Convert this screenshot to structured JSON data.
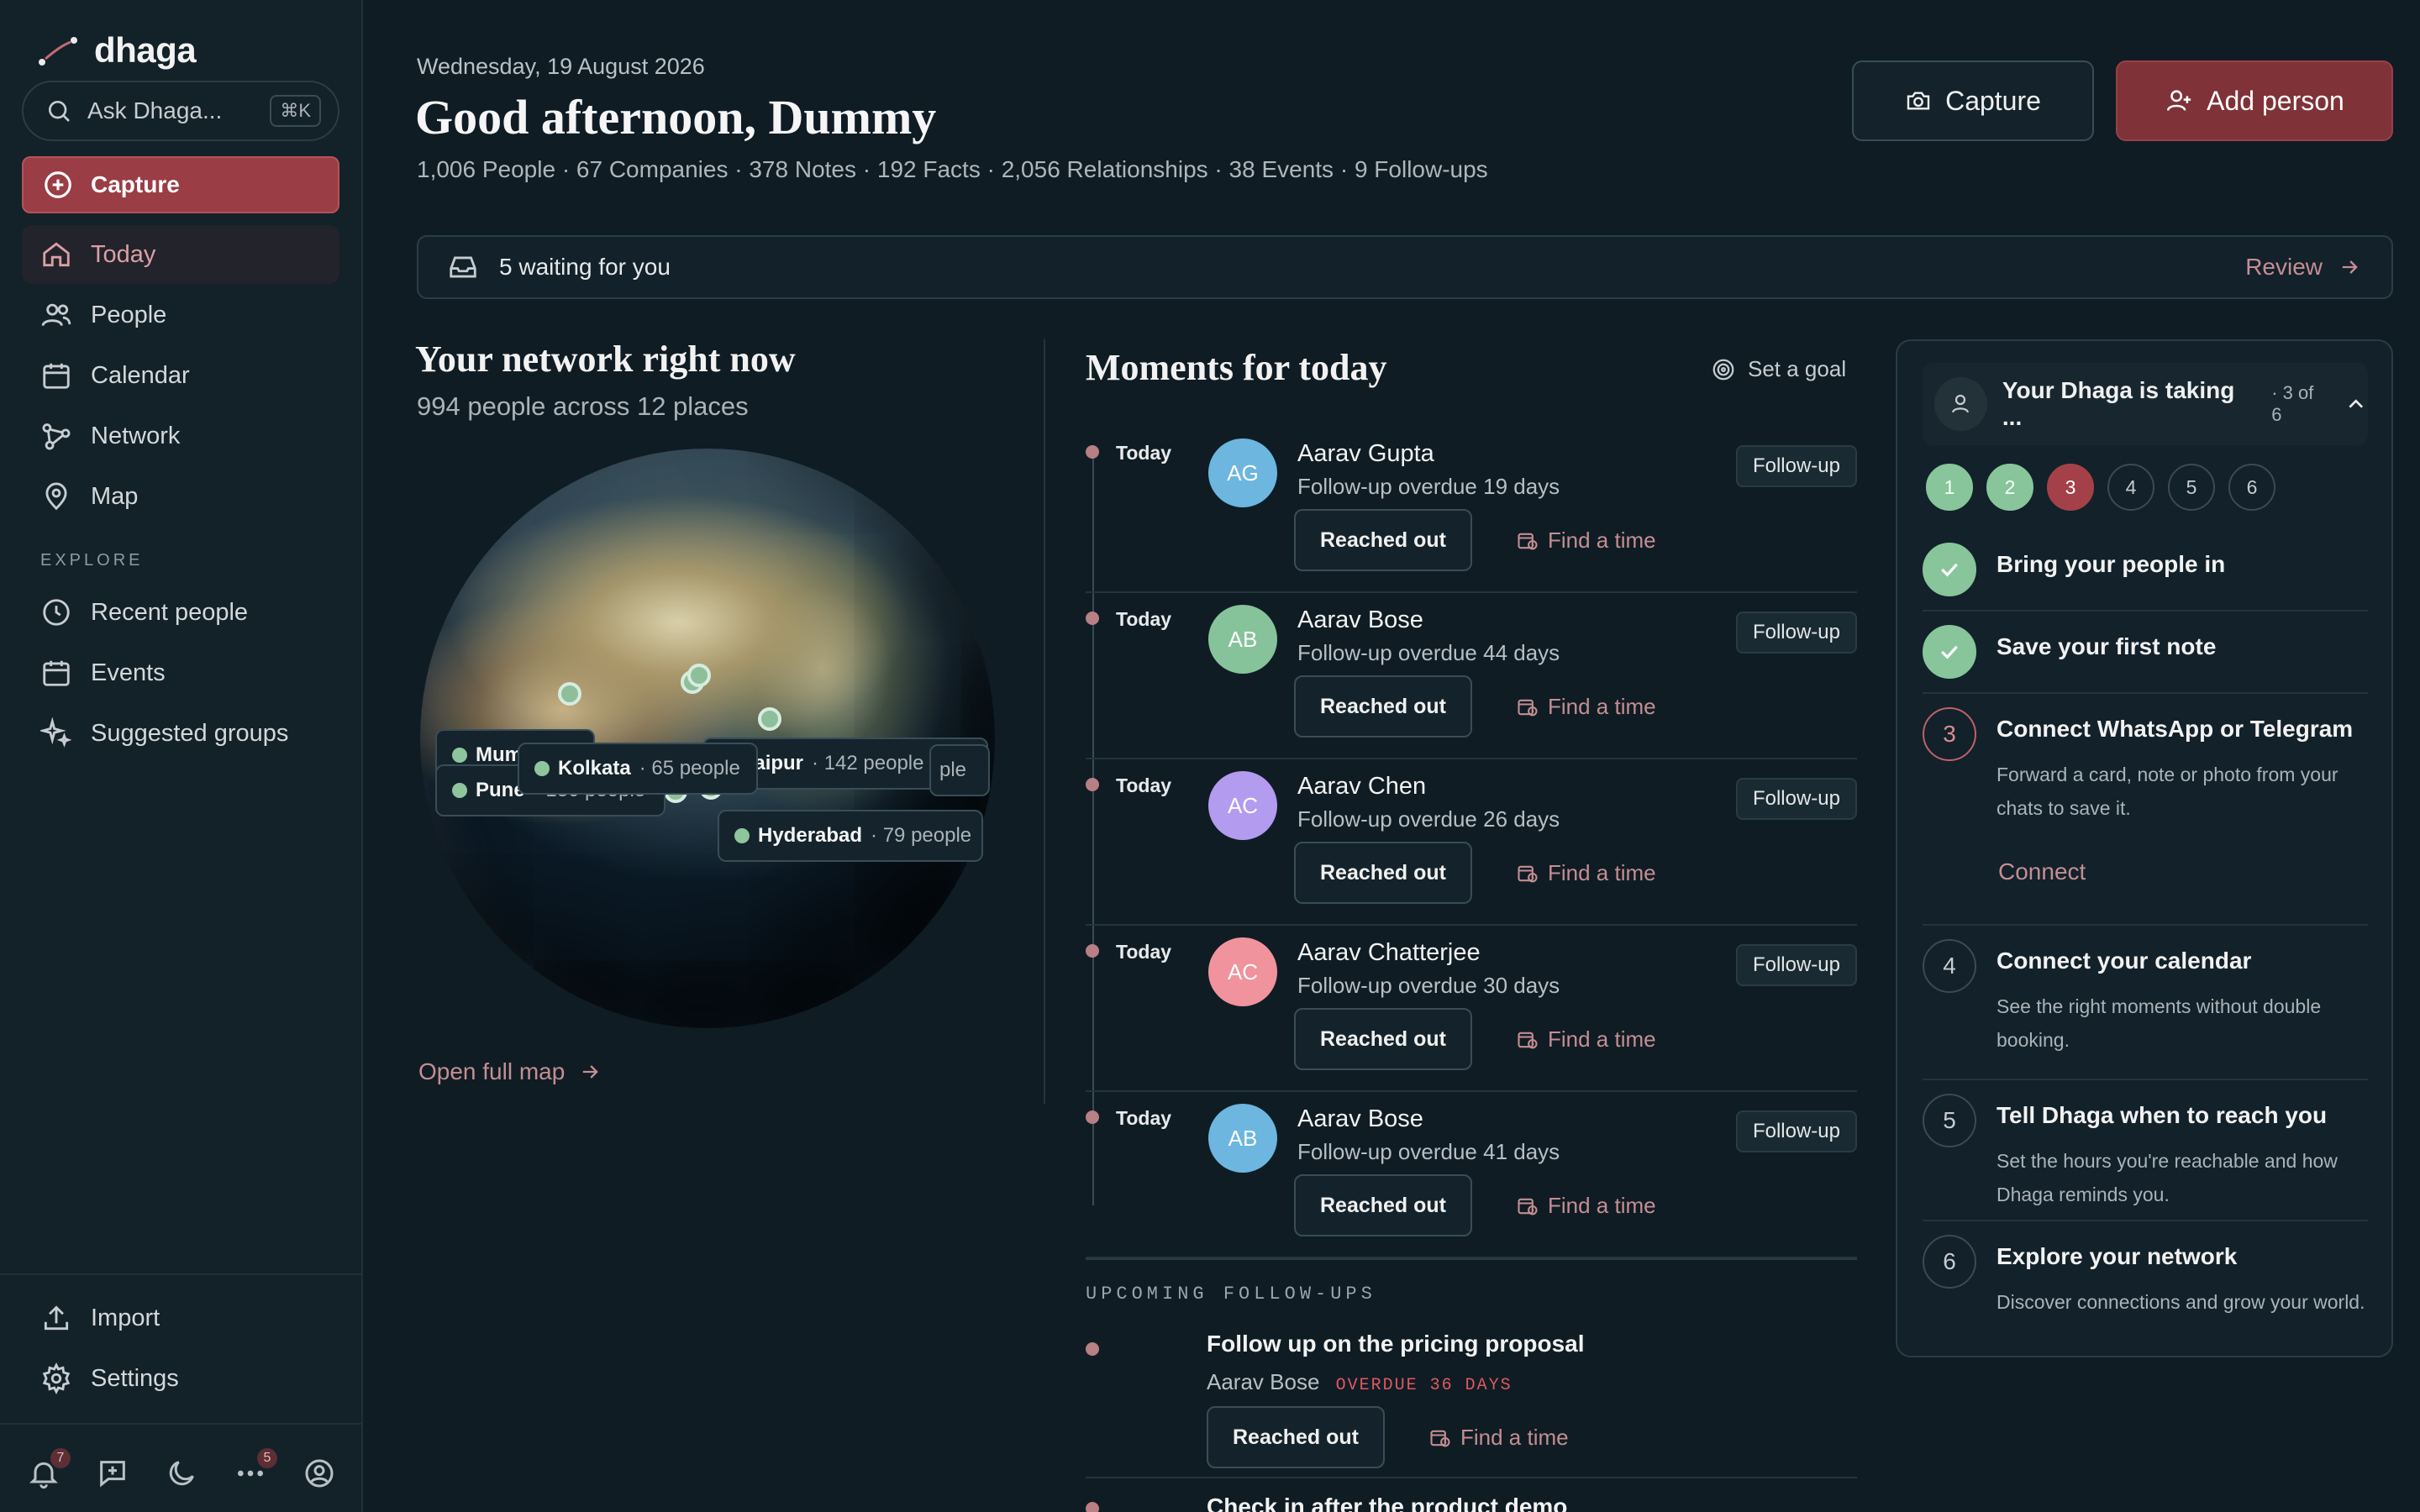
{
  "app": {
    "name": "dhaga"
  },
  "sidebar": {
    "search_placeholder": "Ask Dhaga...",
    "search_shortcut": "⌘K",
    "capture_label": "Capture",
    "nav": [
      {
        "label": "Today",
        "icon": "home-icon",
        "active": true
      },
      {
        "label": "People",
        "icon": "people-icon"
      },
      {
        "label": "Calendar",
        "icon": "calendar-icon"
      },
      {
        "label": "Network",
        "icon": "network-icon"
      },
      {
        "label": "Map",
        "icon": "map-pin-icon"
      }
    ],
    "explore_label": "EXPLORE",
    "explore": [
      {
        "label": "Recent people",
        "icon": "clock-icon"
      },
      {
        "label": "Events",
        "icon": "calendar-icon"
      },
      {
        "label": "Suggested groups",
        "icon": "sparkle-icon"
      }
    ],
    "footer": [
      {
        "label": "Import",
        "icon": "upload-icon"
      },
      {
        "label": "Settings",
        "icon": "gear-icon"
      }
    ],
    "bottom_icons": [
      {
        "icon": "bell-icon",
        "badge": "7"
      },
      {
        "icon": "feedback-icon",
        "badge": ""
      },
      {
        "icon": "moon-icon",
        "badge": ""
      },
      {
        "icon": "more-icon",
        "badge": "5"
      },
      {
        "icon": "account-icon",
        "badge": ""
      }
    ]
  },
  "header": {
    "date": "Wednesday, 19 August 2026",
    "greeting": "Good afternoon, Dummy",
    "stats": "1,006 People · 67 Companies · 378 Notes · 192 Facts · 2,056 Relationships · 38 Events · 9 Follow-ups",
    "capture_button": "Capture",
    "add_person_button": "Add person"
  },
  "waiting": {
    "text": "5 waiting for you",
    "action": "Review"
  },
  "network": {
    "title": "Your network right now",
    "subtitle": "994 people across 12 places",
    "cities": [
      {
        "name": "Mum",
        "count": ""
      },
      {
        "name": "Pune",
        "count": "· 130 people"
      },
      {
        "name": "Kolkata",
        "count": "· 65 people"
      },
      {
        "name": "Jaipur",
        "count": "· 142 people"
      },
      {
        "name": "",
        "count": "ple"
      },
      {
        "name": "Hyderabad",
        "count": "· 79 people"
      }
    ],
    "open_map": "Open full map"
  },
  "moments": {
    "title": "Moments for today",
    "set_goal": "Set a goal",
    "items": [
      {
        "when": "Today",
        "initials": "AG",
        "color": "#6cb6e0",
        "name": "Aarav Gupta",
        "detail": "Follow-up overdue 19 days",
        "tag": "Follow-up",
        "primary": "Reached out",
        "secondary": "Find a time"
      },
      {
        "when": "Today",
        "initials": "AB",
        "color": "#86c39b",
        "name": "Aarav Bose",
        "detail": "Follow-up overdue 44 days",
        "tag": "Follow-up",
        "primary": "Reached out",
        "secondary": "Find a time"
      },
      {
        "when": "Today",
        "initials": "AC",
        "color": "#b39bef",
        "name": "Aarav Chen",
        "detail": "Follow-up overdue 26 days",
        "tag": "Follow-up",
        "primary": "Reached out",
        "secondary": "Find a time"
      },
      {
        "when": "Today",
        "initials": "AC",
        "color": "#f0939d",
        "name": "Aarav Chatterjee",
        "detail": "Follow-up overdue 30 days",
        "tag": "Follow-up",
        "primary": "Reached out",
        "secondary": "Find a time"
      },
      {
        "when": "Today",
        "initials": "AB",
        "color": "#6cb6e0",
        "name": "Aarav Bose",
        "detail": "Follow-up overdue 41 days",
        "tag": "Follow-up",
        "primary": "Reached out",
        "secondary": "Find a time"
      }
    ]
  },
  "upcoming": {
    "label": "UPCOMING FOLLOW-UPS",
    "items": [
      {
        "title": "Follow up on the pricing proposal",
        "who": "Aarav Bose",
        "status": "OVERDUE 36 DAYS",
        "primary": "Reached out",
        "secondary": "Find a time"
      }
    ],
    "next_title": "Check in after the product demo"
  },
  "onboarding": {
    "title": "Your Dhaga is taking ...",
    "progress": "· 3 of 6",
    "steps": [
      "1",
      "2",
      "3",
      "4",
      "5",
      "6"
    ],
    "tasks": [
      {
        "num": "1",
        "title": "Bring your people in",
        "desc": "",
        "state": "done"
      },
      {
        "num": "2",
        "title": "Save your first note",
        "desc": "",
        "state": "done"
      },
      {
        "num": "3",
        "title": "Connect WhatsApp or Telegram",
        "desc": "Forward a card, note or photo from your chats to save it.",
        "state": "current",
        "action": "Connect"
      },
      {
        "num": "4",
        "title": "Connect your calendar",
        "desc": "See the right moments without double booking.",
        "state": "todo"
      },
      {
        "num": "5",
        "title": "Tell Dhaga when to reach you",
        "desc": "Set the hours you're reachable and how Dhaga reminds you.",
        "state": "todo"
      },
      {
        "num": "6",
        "title": "Explore your network",
        "desc": "Discover connections and grow your world.",
        "state": "todo"
      }
    ]
  },
  "colors": {
    "accent": "#9a3d45",
    "link": "#c48e92",
    "success": "#88c59a",
    "background": "#0f1c24"
  }
}
